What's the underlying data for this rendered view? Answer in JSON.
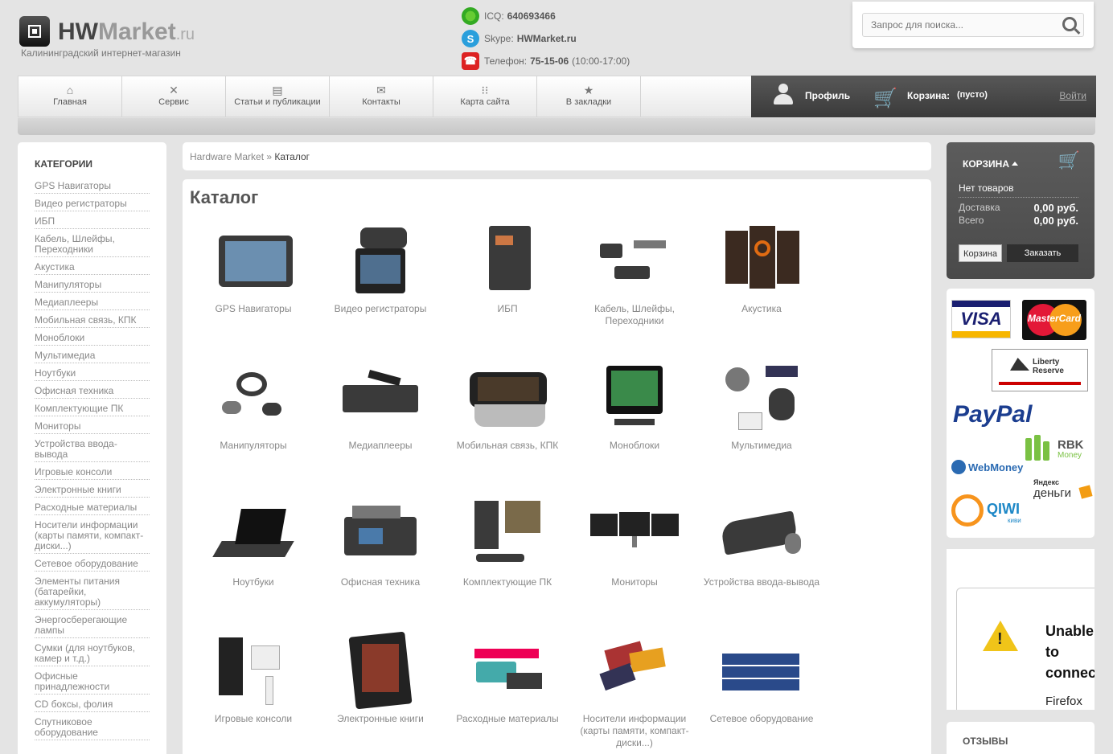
{
  "header": {
    "logo_hw": "HW",
    "logo_market": "Market",
    "logo_ru": ".ru",
    "subtitle": "Калининградский интернет-магазин",
    "icq_label": "ICQ:",
    "icq_value": "640693466",
    "skype_label": "Skype:",
    "skype_value": "HWMarket.ru",
    "phone_label": "Телефон:",
    "phone_value": "75-15-06",
    "phone_hours": "(10:00-17:00)",
    "search_placeholder": "Запрос для поиска..."
  },
  "nav": {
    "items": [
      {
        "label": "Главная",
        "icon": "home-icon"
      },
      {
        "label": "Сервис",
        "icon": "tools-icon"
      },
      {
        "label": "Статьи и публикации",
        "icon": "articles-icon"
      },
      {
        "label": "Контакты",
        "icon": "mail-icon"
      },
      {
        "label": "Карта сайта",
        "icon": "sitemap-icon"
      },
      {
        "label": "В закладки",
        "icon": "star-icon"
      }
    ],
    "profile": "Профиль",
    "cart_label": "Корзина:",
    "cart_status": "(пусто)",
    "login": "Войти"
  },
  "sidebar": {
    "title": "КАТЕГОРИИ",
    "items": [
      "GPS Навигаторы",
      "Видео регистраторы",
      "ИБП",
      "Кабель, Шлейфы, Переходники",
      "Акустика",
      "Манипуляторы",
      "Медиаплееры",
      "Мобильная связь, КПК",
      "Моноблоки",
      "Мультимедиа",
      "Ноутбуки",
      "Офисная техника",
      "Комплектующие ПК",
      "Мониторы",
      "Устройства ввода-вывода",
      "Игровые консоли",
      "Электронные книги",
      "Расходные материалы",
      "Носители информации (карты памяти, компакт-диски...)",
      "Сетевое оборудование",
      "Элементы питания (батарейки, аккумуляторы)",
      "Энергосберегающие лампы",
      "Сумки (для ноутбуков, камер и т.д.)",
      "Офисные принадлежности",
      "CD боксы, фолия",
      "Спутниковое оборудование"
    ]
  },
  "breadcrumb": {
    "root": "Hardware Market",
    "sep": "»",
    "current": "Каталог"
  },
  "catalog": {
    "title": "Каталог",
    "items": [
      "GPS Навигаторы",
      "Видео регистраторы",
      "ИБП",
      "Кабель, Шлейфы, Переходники",
      "Акустика",
      "Манипуляторы",
      "Медиаплееры",
      "Мобильная связь, КПК",
      "Моноблоки",
      "Мультимедиа",
      "Ноутбуки",
      "Офисная техника",
      "Комплектующие ПК",
      "Мониторы",
      "Устройства ввода-вывода",
      "Игровые консоли",
      "Электронные книги",
      "Расходные материалы",
      "Носители информации (карты памяти, компакт-диски...)",
      "Сетевое оборудование"
    ]
  },
  "cart": {
    "title": "КОРЗИНА",
    "empty": "Нет товаров",
    "delivery_label": "Доставка",
    "delivery_value": "0,00 руб.",
    "total_label": "Всего",
    "total_value": "0,00 руб.",
    "btn_cart": "Корзина",
    "btn_order": "Заказать"
  },
  "payments": {
    "visa": "VISA",
    "mastercard": "MasterCard",
    "liberty": "Liberty Reserve",
    "paypal": "PayPal",
    "rbk": "RBK",
    "rbk_sub": "Money",
    "webmoney": "WebMoney",
    "yandex_top": "Яндекс",
    "yandex_bottom": "деньги",
    "qiwi": "QIWI",
    "qiwi_sub": "киви"
  },
  "widget": {
    "line1": "Unable",
    "line2": "to",
    "line3": "connect",
    "browser": "Firefox"
  },
  "reviews_title": "ОТЗЫВЫ",
  "colors": {
    "accent_dark": "#4a4a4a",
    "paypal": "#1b3d8f",
    "visa": "#1a1f71",
    "mastercard": "#e31837"
  }
}
